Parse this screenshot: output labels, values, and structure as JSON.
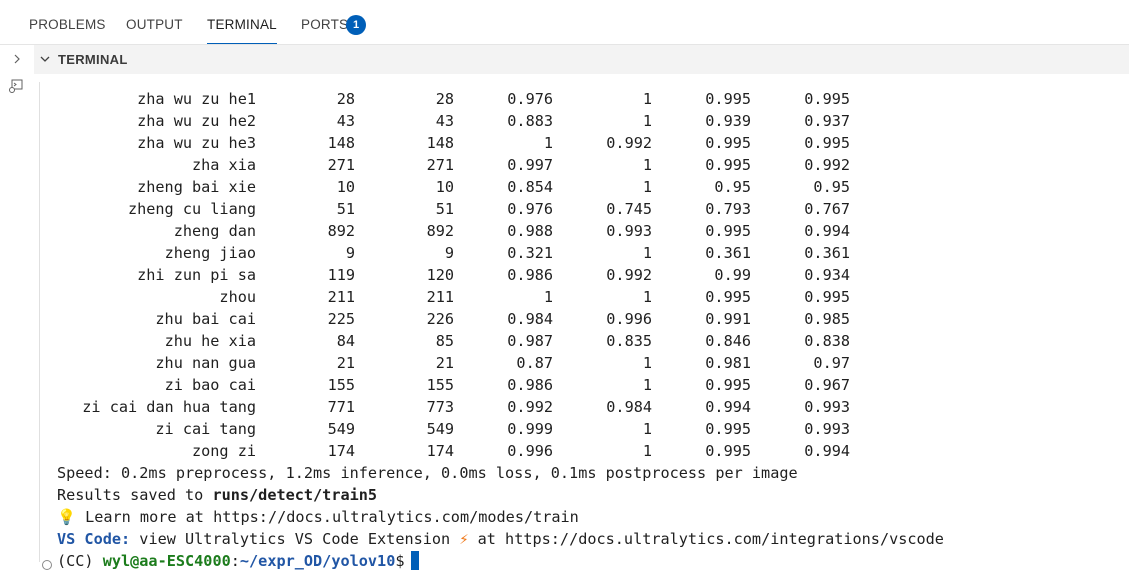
{
  "tabs": [
    {
      "label": "PROBLEMS"
    },
    {
      "label": "OUTPUT"
    },
    {
      "label": "TERMINAL"
    },
    {
      "label": "PORTS"
    }
  ],
  "ports_badge": "1",
  "section_title": "TERMINAL",
  "colors": {
    "accent": "#005fb8",
    "prompt_green": "#1c7c1c",
    "link_blue": "#2156a5"
  },
  "icons": {
    "expand": "chevron-right-icon",
    "new_terminal": "terminal-icon",
    "section_toggle": "chevron-down-icon",
    "learn_more": "lightbulb-icon",
    "extension": "lightning-icon",
    "status": "circle-icon"
  },
  "rows": [
    {
      "cls": "zha wu zu he1",
      "images": "28",
      "instances": "28",
      "p": "0.976",
      "r": "1",
      "map50": "0.995",
      "map": "0.995"
    },
    {
      "cls": "zha wu zu he2",
      "images": "43",
      "instances": "43",
      "p": "0.883",
      "r": "1",
      "map50": "0.939",
      "map": "0.937"
    },
    {
      "cls": "zha wu zu he3",
      "images": "148",
      "instances": "148",
      "p": "1",
      "r": "0.992",
      "map50": "0.995",
      "map": "0.995"
    },
    {
      "cls": "zha xia",
      "images": "271",
      "instances": "271",
      "p": "0.997",
      "r": "1",
      "map50": "0.995",
      "map": "0.992"
    },
    {
      "cls": "zheng bai xie",
      "images": "10",
      "instances": "10",
      "p": "0.854",
      "r": "1",
      "map50": "0.95",
      "map": "0.95"
    },
    {
      "cls": "zheng cu liang",
      "images": "51",
      "instances": "51",
      "p": "0.976",
      "r": "0.745",
      "map50": "0.793",
      "map": "0.767"
    },
    {
      "cls": "zheng dan",
      "images": "892",
      "instances": "892",
      "p": "0.988",
      "r": "0.993",
      "map50": "0.995",
      "map": "0.994"
    },
    {
      "cls": "zheng jiao",
      "images": "9",
      "instances": "9",
      "p": "0.321",
      "r": "1",
      "map50": "0.361",
      "map": "0.361"
    },
    {
      "cls": "zhi zun pi sa",
      "images": "119",
      "instances": "120",
      "p": "0.986",
      "r": "0.992",
      "map50": "0.99",
      "map": "0.934"
    },
    {
      "cls": "zhou",
      "images": "211",
      "instances": "211",
      "p": "1",
      "r": "1",
      "map50": "0.995",
      "map": "0.995"
    },
    {
      "cls": "zhu bai cai",
      "images": "225",
      "instances": "226",
      "p": "0.984",
      "r": "0.996",
      "map50": "0.991",
      "map": "0.985"
    },
    {
      "cls": "zhu he xia",
      "images": "84",
      "instances": "85",
      "p": "0.987",
      "r": "0.835",
      "map50": "0.846",
      "map": "0.838"
    },
    {
      "cls": "zhu nan gua",
      "images": "21",
      "instances": "21",
      "p": "0.87",
      "r": "1",
      "map50": "0.981",
      "map": "0.97"
    },
    {
      "cls": "zi bao cai",
      "images": "155",
      "instances": "155",
      "p": "0.986",
      "r": "1",
      "map50": "0.995",
      "map": "0.967"
    },
    {
      "cls": "zi cai dan hua tang",
      "images": "771",
      "instances": "773",
      "p": "0.992",
      "r": "0.984",
      "map50": "0.994",
      "map": "0.993"
    },
    {
      "cls": "zi cai tang",
      "images": "549",
      "instances": "549",
      "p": "0.999",
      "r": "1",
      "map50": "0.995",
      "map": "0.993"
    },
    {
      "cls": "zong zi",
      "images": "174",
      "instances": "174",
      "p": "0.996",
      "r": "1",
      "map50": "0.995",
      "map": "0.994"
    }
  ],
  "speed_line": "Speed: 0.2ms preprocess, 1.2ms inference, 0.0ms loss, 0.1ms postprocess per image",
  "results": {
    "prefix": "Results saved to ",
    "path": "runs/detect/train5"
  },
  "learn": {
    "icon": "💡",
    "text": " Learn more at https://docs.ultralytics.com/modes/train"
  },
  "vscode": {
    "label": "VS Code:",
    "text": " view Ultralytics VS Code Extension ",
    "icon": "⚡",
    "suffix": " at https://docs.ultralytics.com/integrations/vscode"
  },
  "prompt": {
    "env": "(CC) ",
    "user": "wyl@aa-ESC4000",
    "colon": ":",
    "path": "~/expr_OD/yolov10",
    "dollar": "$"
  }
}
